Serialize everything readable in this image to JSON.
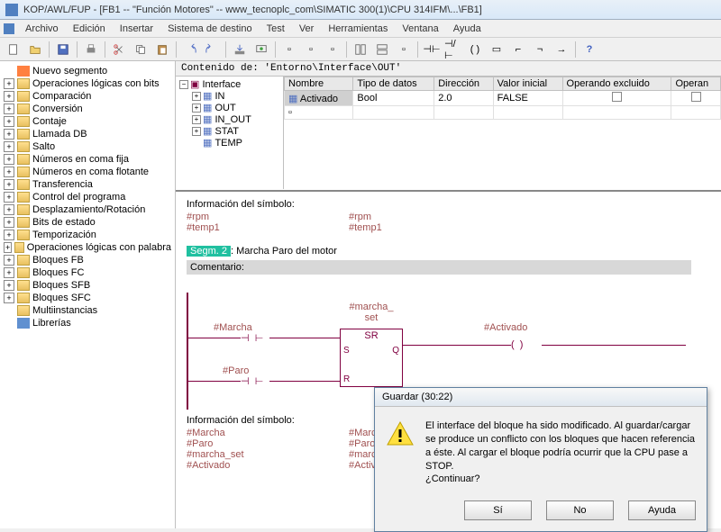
{
  "title": "KOP/AWL/FUP  - [FB1 -- \"Función Motores\" -- www_tecnoplc_com\\SIMATIC 300(1)\\CPU 314IFM\\...\\FB1]",
  "menu": [
    "Archivo",
    "Edición",
    "Insertar",
    "Sistema de destino",
    "Test",
    "Ver",
    "Herramientas",
    "Ventana",
    "Ayuda"
  ],
  "sidebar": {
    "items": [
      {
        "label": "Nuevo segmento",
        "icon": "seg"
      },
      {
        "label": "Operaciones lógicas con bits",
        "icon": "folder"
      },
      {
        "label": "Comparación",
        "icon": "folder"
      },
      {
        "label": "Conversión",
        "icon": "folder"
      },
      {
        "label": "Contaje",
        "icon": "folder"
      },
      {
        "label": "Llamada DB",
        "icon": "folder"
      },
      {
        "label": "Salto",
        "icon": "folder"
      },
      {
        "label": "Números en coma fija",
        "icon": "folder"
      },
      {
        "label": "Números en coma flotante",
        "icon": "folder"
      },
      {
        "label": "Transferencia",
        "icon": "folder"
      },
      {
        "label": "Control del programa",
        "icon": "folder"
      },
      {
        "label": "Desplazamiento/Rotación",
        "icon": "folder"
      },
      {
        "label": "Bits de estado",
        "icon": "folder"
      },
      {
        "label": "Temporización",
        "icon": "folder"
      },
      {
        "label": "Operaciones lógicas con palabra",
        "icon": "folder"
      },
      {
        "label": "Bloques FB",
        "icon": "folder"
      },
      {
        "label": "Bloques FC",
        "icon": "folder"
      },
      {
        "label": "Bloques SFB",
        "icon": "folder"
      },
      {
        "label": "Bloques SFC",
        "icon": "folder"
      },
      {
        "label": "Multiinstancias",
        "icon": "multi"
      },
      {
        "label": "Librerías",
        "icon": "lib"
      }
    ]
  },
  "interface": {
    "content_of": "Contenido de: 'Entorno\\Interface\\OUT'",
    "root": "Interface",
    "nodes": [
      "IN",
      "OUT",
      "IN_OUT",
      "STAT",
      "TEMP"
    ],
    "columns": [
      "Nombre",
      "Tipo de datos",
      "Dirección",
      "Valor inicial",
      "Operando excluido",
      "Operan"
    ],
    "row": {
      "nombre": "Activado",
      "tipo": "Bool",
      "dir": "2.0",
      "val": "FALSE"
    }
  },
  "editor": {
    "info1_title": "Información del símbolo:",
    "info1": [
      [
        "#rpm",
        "#rpm"
      ],
      [
        "#temp1",
        "#temp1"
      ]
    ],
    "segm_label": "Segm. 2",
    "segm_title": ": Marcha Paro del motor",
    "comment_label": "Comentario:",
    "ladder": {
      "marcha_set": "#marcha_\nset",
      "marcha": "#Marcha",
      "paro": "#Paro",
      "activado": "#Activado",
      "sr": "SR",
      "s": "S",
      "r": "R",
      "q": "Q"
    },
    "info2_title": "Información del símbolo:",
    "info2": [
      [
        "#Marcha",
        "#Marcha"
      ],
      [
        "#Paro",
        "#Paro"
      ],
      [
        "#marcha_set",
        "#marcha_set"
      ],
      [
        "#Activado",
        "#Activado"
      ]
    ]
  },
  "dialog": {
    "title": "Guardar (30:22)",
    "msg": "El interface del bloque ha sido modificado. Al guardar/cargar se produce un conflicto con los bloques que hacen referencia a éste. Al cargar el bloque podría ocurrir que la CPU pase a STOP.\n¿Continuar?",
    "yes": "Sí",
    "no": "No",
    "help": "Ayuda"
  }
}
